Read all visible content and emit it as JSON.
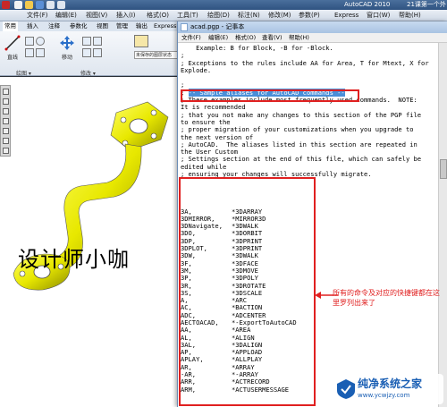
{
  "title_bar": {
    "app_title": "AutoCAD 2010",
    "right_text": "21课第一个外"
  },
  "menubar": {
    "items": [
      "文件(F)",
      "编辑(E)",
      "视图(V)",
      "插入(I)",
      "格式(O)",
      "工具(T)",
      "绘图(D)",
      "标注(N)",
      "修改(M)",
      "参数(P)",
      "Express",
      "窗口(W)",
      "帮助(H)"
    ]
  },
  "ribbon": {
    "tabs": [
      "常用",
      "插入",
      "注释",
      "参数化",
      "视图",
      "管理",
      "输出",
      "Express Tools"
    ],
    "buttons": {
      "line": "直线",
      "move": "移动"
    },
    "groups": {
      "draw": "绘图 ▾",
      "modify": "修改 ▾"
    },
    "extra_labels": [
      "未保存的图层状态"
    ]
  },
  "notepad": {
    "title": "acad.pgp - 记事本",
    "menu": [
      "文件(F)",
      "编辑(E)",
      "格式(O)",
      "查看(V)",
      "帮助(H)"
    ],
    "lines_top": [
      "    Example: B for Block, -B for -Block.",
      ";",
      "; Exceptions to the rules include AA for Area, T for Mtext, X for",
      "Explode.",
      "",
      ";"
    ],
    "highlight_line": "-- Sample aliases for AutoCAD commands --",
    "lines_mid": [
      "; These examples include most frequently used commands.  NOTE:",
      "It is recommended",
      "; that you not make any changes to this section of the PGP file",
      "to ensure the",
      "; proper migration of your customizations when you upgrade to",
      "the next version of",
      "; AutoCAD.  The aliases listed in this section are repeated in",
      "the User Custom",
      "; Settings section at the end of this file, which can safely be",
      "edited while",
      "; ensuring your changes will successfully migrate.",
      "",
      "",
      "",
      ""
    ],
    "aliases": [
      [
        "3A,",
        "*3DARRAY"
      ],
      [
        "3DMIRROR,",
        "*MIRROR3D"
      ],
      [
        "3DNavigate,",
        "*3DWALK"
      ],
      [
        "3DO,",
        "*3DORBIT"
      ],
      [
        "3DP,",
        "*3DPRINT"
      ],
      [
        "3DPLOT,",
        "*3DPRINT"
      ],
      [
        "3DW,",
        "*3DWALK"
      ],
      [
        "3F,",
        "*3DFACE"
      ],
      [
        "3M,",
        "*3DMOVE"
      ],
      [
        "3P,",
        "*3DPOLY"
      ],
      [
        "3R,",
        "*3DROTATE"
      ],
      [
        "3S,",
        "*3DSCALE"
      ],
      [
        "A,",
        "*ARC"
      ],
      [
        "AC,",
        "*BACTION"
      ],
      [
        "ADC,",
        "*ADCENTER"
      ],
      [
        "AECTOACAD,",
        "*-ExportToAutoCAD"
      ],
      [
        "AA,",
        "*AREA"
      ],
      [
        "AL,",
        "*ALIGN"
      ],
      [
        "3AL,",
        "*3DALIGN"
      ],
      [
        "AP,",
        "*APPLOAD"
      ],
      [
        "APLAY,",
        "*ALLPLAY"
      ],
      [
        "AR,",
        "*ARRAY"
      ],
      [
        "-AR,",
        "*-ARRAY"
      ],
      [
        "ARR,",
        "*ACTRECORD"
      ],
      [
        "ARM,",
        "*ACTUSERMESSAGE"
      ]
    ]
  },
  "watermark": "设计师小咖",
  "annotation": "所有的命令及对应的快捷键都在这里罗列出来了",
  "logo": {
    "name": "纯净系统之家",
    "url": "www.ycwjzy.com"
  },
  "colors": {
    "highlight": "#e02020",
    "pipe": "#e8e800",
    "selection": "#4a8fd8"
  }
}
